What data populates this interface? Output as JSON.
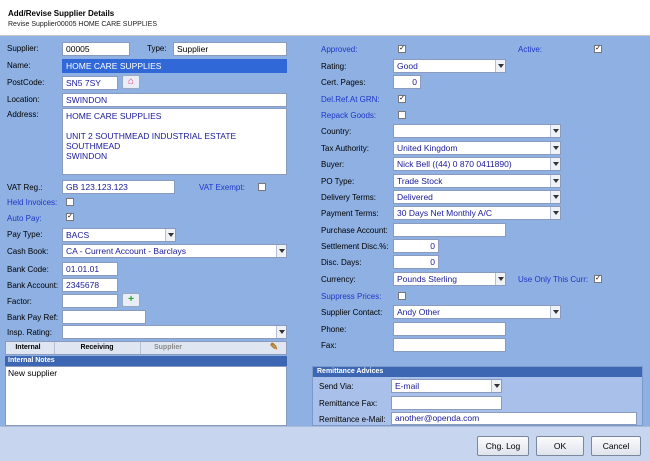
{
  "header": {
    "title": "Add/Revise Supplier Details",
    "subtitle": "Revise Supplier00005 HOME CARE SUPPLIES"
  },
  "left": {
    "supplier_label": "Supplier:",
    "supplier_value": "00005",
    "type_label": "Type:",
    "type_value": "Supplier",
    "name_label": "Name:",
    "name_value": "HOME CARE SUPPLIES",
    "postcode_label": "PostCode:",
    "postcode_value": "SN5 7SY",
    "location_label": "Location:",
    "location_value": "SWINDON",
    "address_label": "Address:",
    "address_value": "HOME CARE SUPPLIES\n\nUNIT 2 SOUTHMEAD INDUSTRIAL ESTATE\nSOUTHMEAD\nSWINDON",
    "vat_label": "VAT Reg.:",
    "vat_value": "GB 123.123.123",
    "vat_exempt_label": "VAT Exempt:",
    "held_invoices_label": "Held Invoices:",
    "auto_pay_label": "Auto Pay:",
    "pay_type_label": "Pay Type:",
    "pay_type_value": "BACS",
    "cash_book_label": "Cash Book:",
    "cash_book_value": "CA - Current Account - Barclays",
    "bank_code_label": "Bank Code:",
    "bank_code_value": "01.01.01",
    "bank_account_label": "Bank Account:",
    "bank_account_value": "2345678",
    "factor_label": "Factor:",
    "factor_value": "",
    "bank_pay_ref_label": "Bank Pay Ref:",
    "bank_pay_ref_value": "",
    "insp_rating_label": "Insp. Rating:",
    "insp_rating_value": ""
  },
  "tabs": {
    "internal": "Internal",
    "receiving": "Receiving",
    "supplier": "Supplier"
  },
  "notes": {
    "header": "Internal Notes",
    "text": "New supplier"
  },
  "right": {
    "approved_label": "Approved:",
    "active_label": "Active:",
    "rating_label": "Rating:",
    "rating_value": "Good",
    "cert_pages_label": "Cert. Pages:",
    "cert_pages_value": "0",
    "del_ref_label": "Del.Ref.At GRN:",
    "repack_label": "Repack Goods:",
    "country_label": "Country:",
    "country_value": "",
    "tax_authority_label": "Tax Authority:",
    "tax_authority_value": "United Kingdom",
    "buyer_label": "Buyer:",
    "buyer_value": "Nick Bell ((44) 0 870 0411890)",
    "po_type_label": "PO Type:",
    "po_type_value": "Trade Stock",
    "delivery_terms_label": "Delivery Terms:",
    "delivery_terms_value": "Delivered",
    "payment_terms_label": "Payment Terms:",
    "payment_terms_value": "30 Days Net Monthly A/C",
    "purchase_account_label": "Purchase Account:",
    "purchase_account_value": "",
    "settlement_label": "Settlement Disc.%:",
    "settlement_value": "0",
    "disc_days_label": "Disc. Days:",
    "disc_days_value": "0",
    "currency_label": "Currency:",
    "currency_value": "Pounds Sterling",
    "use_only_label": "Use Only This Curr:",
    "suppress_prices_label": "Suppress Prices:",
    "supplier_contact_label": "Supplier Contact:",
    "supplier_contact_value": "Andy Other",
    "phone_label": "Phone:",
    "phone_value": "",
    "fax_label": "Fax:",
    "fax_value": ""
  },
  "remittance": {
    "header": "Remittance Advices",
    "send_via_label": "Send Via:",
    "send_via_value": "E-mail",
    "fax_label": "Remittance Fax:",
    "fax_value": "",
    "email_label": "Remittance e-Mail:",
    "email_value": "another@openda.com"
  },
  "buttons": {
    "chg_log": "Chg. Log",
    "ok": "OK",
    "cancel": "Cancel"
  },
  "checks": {
    "check_mark": "✓"
  },
  "icons": {
    "postcode_lookup": "house-icon",
    "factor_add": "plus-icon",
    "notes_edit": "pencil-icon"
  },
  "colors": {
    "panel_bg": "#8eb0e3",
    "section_header": "#3e67b3",
    "selected_field": "#3168d8",
    "blue_label": "#1f36c7"
  }
}
